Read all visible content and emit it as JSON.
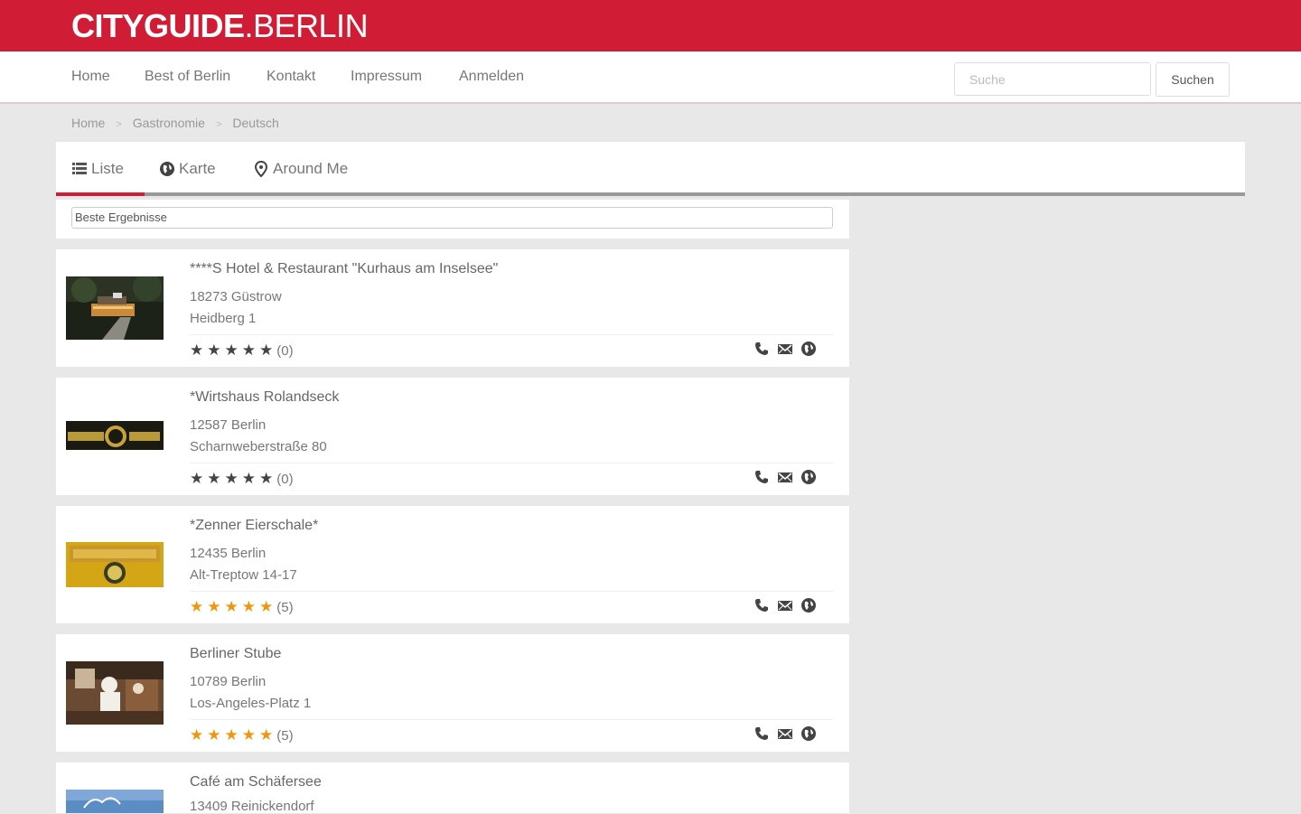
{
  "header": {
    "logo_bold": "CITYGUIDE",
    "logo_rest": ".BERLIN",
    "brand_color": "#d11c36"
  },
  "nav": {
    "items": [
      "Home",
      "Best of Berlin",
      "Kontakt",
      "Impressum",
      "Anmelden"
    ],
    "search_placeholder": "Suche",
    "search_button": "Suchen"
  },
  "breadcrumb": [
    "Home",
    "Gastronomie",
    "Deutsch"
  ],
  "tabs": [
    {
      "label": "Liste",
      "icon": "list-icon",
      "active": true
    },
    {
      "label": "Karte",
      "icon": "globe-icon",
      "active": false
    },
    {
      "label": "Around Me",
      "icon": "map-pin-icon",
      "active": false
    }
  ],
  "filter": {
    "selected": "Beste Ergebnisse"
  },
  "listings": [
    {
      "title": "****S Hotel & Restaurant \"Kurhaus am Inselsee\"",
      "city": "18273 Güstrow",
      "street": "Heidberg 1",
      "rating": 0,
      "reviews": "(0)",
      "thumb": "hotel-night-photo"
    },
    {
      "title": "*Wirtshaus Rolandseck",
      "city": "12587 Berlin",
      "street": "Scharnweberstraße 80",
      "rating": 0,
      "reviews": "(0)",
      "thumb": "rolandseck-logo"
    },
    {
      "title": "*Zenner Eierschale*",
      "city": "12435 Berlin",
      "street": "Alt-Treptow 14-17",
      "rating": 5,
      "reviews": "(5)",
      "thumb": "zenner-logo"
    },
    {
      "title": "Berliner Stube",
      "city": "10789 Berlin",
      "street": "Los-Angeles-Platz 1",
      "rating": 5,
      "reviews": "(5)",
      "thumb": "restaurant-chef-photo"
    },
    {
      "title": "Café am Schäfersee",
      "city": "13409 Reinickendorf",
      "street": "",
      "rating": 0,
      "reviews": "",
      "thumb": "lake-photo"
    }
  ],
  "star_glyph": "★",
  "colors": {
    "star_rated": "#f0960c",
    "star_unrated": "#444444"
  }
}
